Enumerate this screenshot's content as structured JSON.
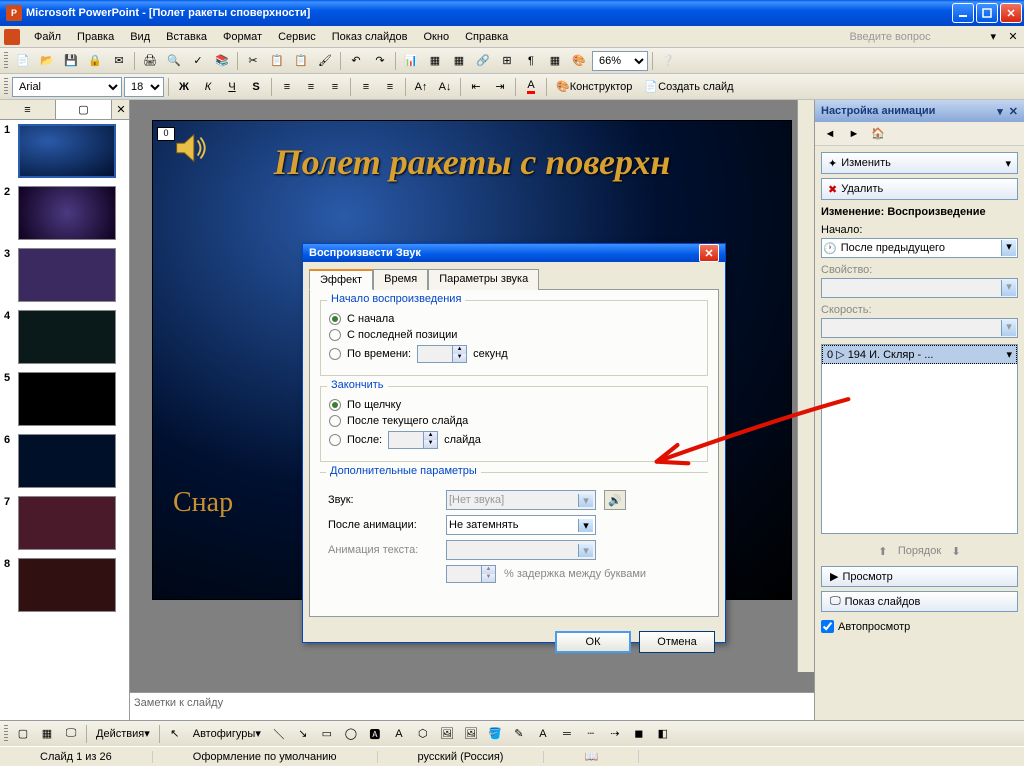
{
  "app": {
    "title": "Microsoft PowerPoint - [Полет ракеты споверхности]"
  },
  "menu": {
    "file": "Файл",
    "edit": "Правка",
    "view": "Вид",
    "insert": "Вставка",
    "format": "Формат",
    "tools": "Сервис",
    "slideshow": "Показ слайдов",
    "window": "Окно",
    "help": "Справка",
    "ask": "Введите вопрос"
  },
  "toolbar": {
    "zoom": "66%",
    "designer": "Конструктор",
    "new_slide": "Создать слайд"
  },
  "font": {
    "name": "Arial",
    "size": "18"
  },
  "slide": {
    "title": "Полет ракеты с поверхн",
    "sub": "Снар",
    "box": "0"
  },
  "notes": {
    "placeholder": "Заметки к слайду"
  },
  "taskpane": {
    "title": "Настройка анимации",
    "change": "Изменить",
    "delete": "Удалить",
    "section_title": "Изменение: Воспроизведение",
    "start_label": "Начало:",
    "start_value": "После предыдущего",
    "prop_label": "Свойство:",
    "speed_label": "Скорость:",
    "item": "0   ▷   194 И. Скляр - ...",
    "order": "Порядок",
    "preview": "Просмотр",
    "slideshow": "Показ слайдов",
    "autopreview": "Автопросмотр"
  },
  "dialog": {
    "title": "Воспроизвести Звук",
    "tab_effect": "Эффект",
    "tab_time": "Время",
    "tab_sound": "Параметры звука",
    "start_group": "Начало воспроизведения",
    "r_begin": "С начала",
    "r_lastpos": "С последней позиции",
    "r_time": "По времени:",
    "seconds": "секунд",
    "end_group": "Закончить",
    "r_click": "По щелчку",
    "r_after_current": "После текущего слайда",
    "r_after": "После:",
    "slides": "слайда",
    "extra_group": "Дополнительные параметры",
    "sound_label": "Звук:",
    "sound_value": "[Нет звука]",
    "after_anim_label": "После анимации:",
    "after_anim_value": "Не затемнять",
    "text_anim_label": "Анимация текста:",
    "delay_label": "% задержка между буквами",
    "ok": "ОК",
    "cancel": "Отмена"
  },
  "bottom": {
    "actions": "Действия",
    "autoshapes": "Автофигуры"
  },
  "status": {
    "slide": "Слайд 1 из 26",
    "design": "Оформление по умолчанию",
    "lang": "русский (Россия)"
  },
  "thumbs": [
    "1",
    "2",
    "3",
    "4",
    "5",
    "6",
    "7",
    "8"
  ]
}
